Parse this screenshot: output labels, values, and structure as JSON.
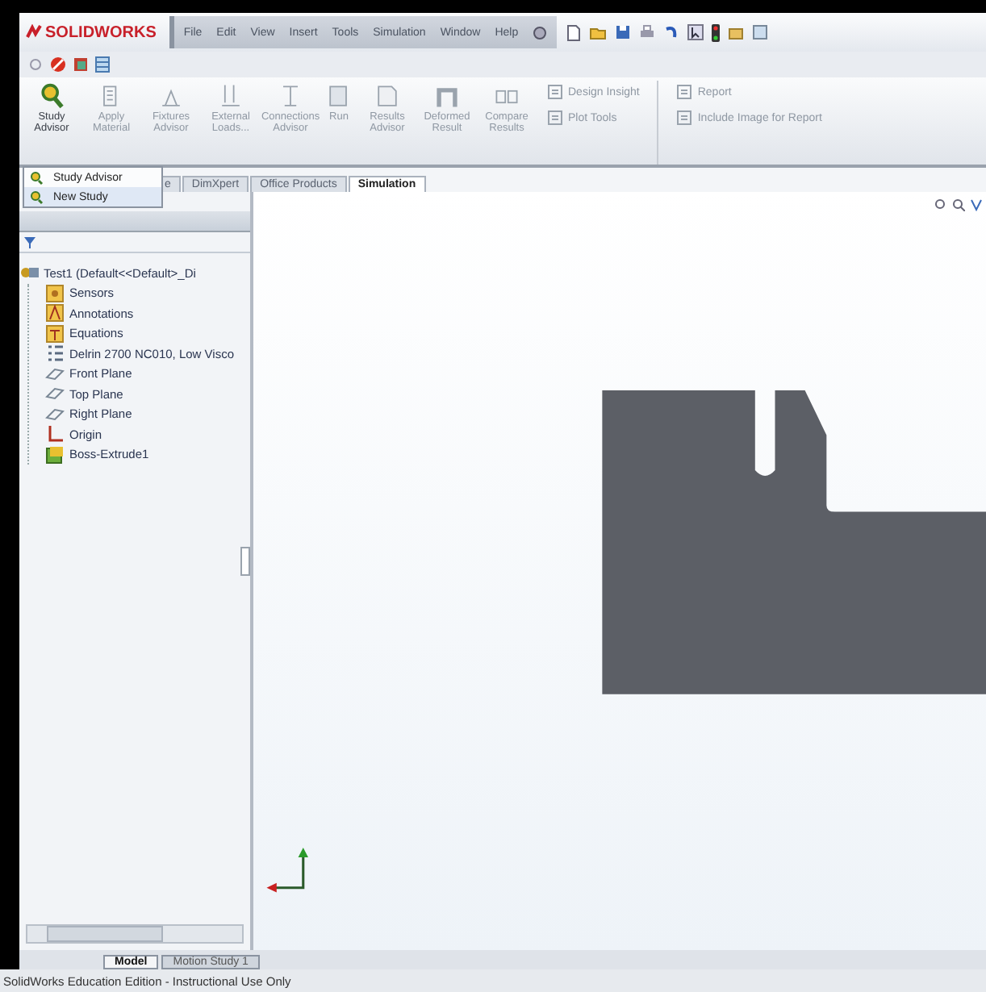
{
  "title_bar": {
    "logo": "SOLIDWORKS",
    "menu": [
      "File",
      "Edit",
      "View",
      "Insert",
      "Tools",
      "Simulation",
      "Window",
      "Help"
    ]
  },
  "command_manager": {
    "large_buttons": [
      {
        "label": "Study Advisor",
        "kind": "magnifier",
        "disabled": false
      },
      {
        "label": "Apply Material",
        "kind": "material",
        "disabled": true
      },
      {
        "label": "Fixtures Advisor",
        "kind": "fixture",
        "disabled": true
      },
      {
        "label": "External Loads...",
        "kind": "load",
        "disabled": true
      },
      {
        "label": "Connections Advisor",
        "kind": "connection",
        "disabled": true
      },
      {
        "label": "Run",
        "kind": "run",
        "disabled": true
      },
      {
        "label": "Results Advisor",
        "kind": "results",
        "disabled": true
      },
      {
        "label": "Deformed Result",
        "kind": "deformed",
        "disabled": true
      },
      {
        "label": "Compare Results",
        "kind": "compare",
        "disabled": true
      }
    ],
    "stacks": [
      [
        {
          "label": "Design Insight",
          "disabled": true
        },
        {
          "label": "Plot Tools",
          "disabled": true
        }
      ],
      [
        {
          "label": "Report",
          "disabled": true
        },
        {
          "label": "Include Image for Report",
          "disabled": true
        }
      ]
    ]
  },
  "tabs": [
    {
      "label": "e",
      "selected": false
    },
    {
      "label": "DimXpert",
      "selected": false
    },
    {
      "label": "Office Products",
      "selected": false
    },
    {
      "label": "Simulation",
      "selected": true
    }
  ],
  "dropdown": [
    {
      "label": "Study Advisor",
      "selected": false
    },
    {
      "label": "New Study",
      "selected": true
    }
  ],
  "feature_tree": {
    "root": {
      "label": "Test1 (Default<<Default>_Di",
      "kind": "part",
      "children": [
        {
          "label": "Sensors",
          "kind": "sensors"
        },
        {
          "label": "Annotations",
          "kind": "annotations"
        },
        {
          "label": "Equations",
          "kind": "equations"
        },
        {
          "label": "Delrin 2700 NC010, Low Visco",
          "kind": "material"
        },
        {
          "label": "Front Plane",
          "kind": "plane"
        },
        {
          "label": "Top Plane",
          "kind": "plane"
        },
        {
          "label": "Right Plane",
          "kind": "plane"
        },
        {
          "label": "Origin",
          "kind": "origin"
        },
        {
          "label": "Boss-Extrude1",
          "kind": "feature"
        }
      ]
    }
  },
  "bottom_tabs": [
    {
      "label": "Model",
      "selected": true
    },
    {
      "label": "Motion Study 1",
      "selected": false
    }
  ],
  "status_bar": "SolidWorks Education Edition - Instructional Use Only"
}
